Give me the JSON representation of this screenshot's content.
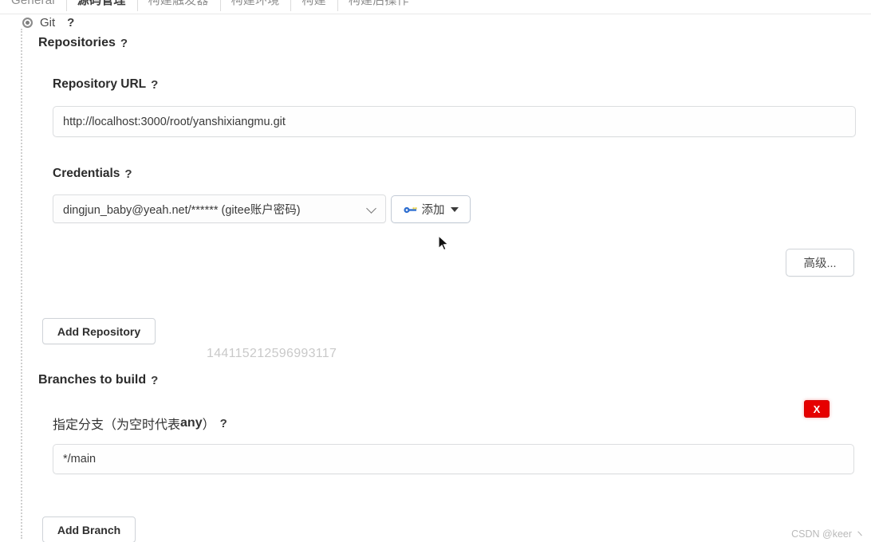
{
  "tabs": [
    {
      "label": "General",
      "active": false
    },
    {
      "label": "源码管理",
      "active": true
    },
    {
      "label": "构建触发器",
      "active": false
    },
    {
      "label": "构建环境",
      "active": false
    },
    {
      "label": "构建",
      "active": false
    },
    {
      "label": "构建后操作",
      "active": false
    }
  ],
  "scm": {
    "radio_label": "Git",
    "help": "?"
  },
  "sections": {
    "repositories_title": "Repositories",
    "repositories_help": "?",
    "branches_title": "Branches to build",
    "branches_help": "?"
  },
  "repository": {
    "url_label": "Repository URL",
    "url_help": "?",
    "url_value": "http://localhost:3000/root/yanshixiangmu.git",
    "url_placeholder": "",
    "credentials_label": "Credentials",
    "credentials_help": "?",
    "credentials_selected": "dingjun_baby@yeah.net/****** (gitee账户密码)",
    "add_credentials_label": "添加",
    "advanced_label": "高级...",
    "add_repository_label": "Add Repository"
  },
  "branches": {
    "branch_label_prefix": "指定分支（为空时代表",
    "branch_label_strong": "any",
    "branch_label_suffix": "）",
    "branch_help": "?",
    "branch_value": "*/main",
    "branch_placeholder": "",
    "delete_label": "X",
    "add_branch_label": "Add Branch"
  },
  "watermarks": {
    "number": "144115212596993117",
    "csdn": "CSDN @keer ヽ"
  },
  "colors": {
    "danger": "#e60000",
    "border": "#dcdee0",
    "text": "#2b2b2b",
    "muted": "#8d8d8d"
  }
}
